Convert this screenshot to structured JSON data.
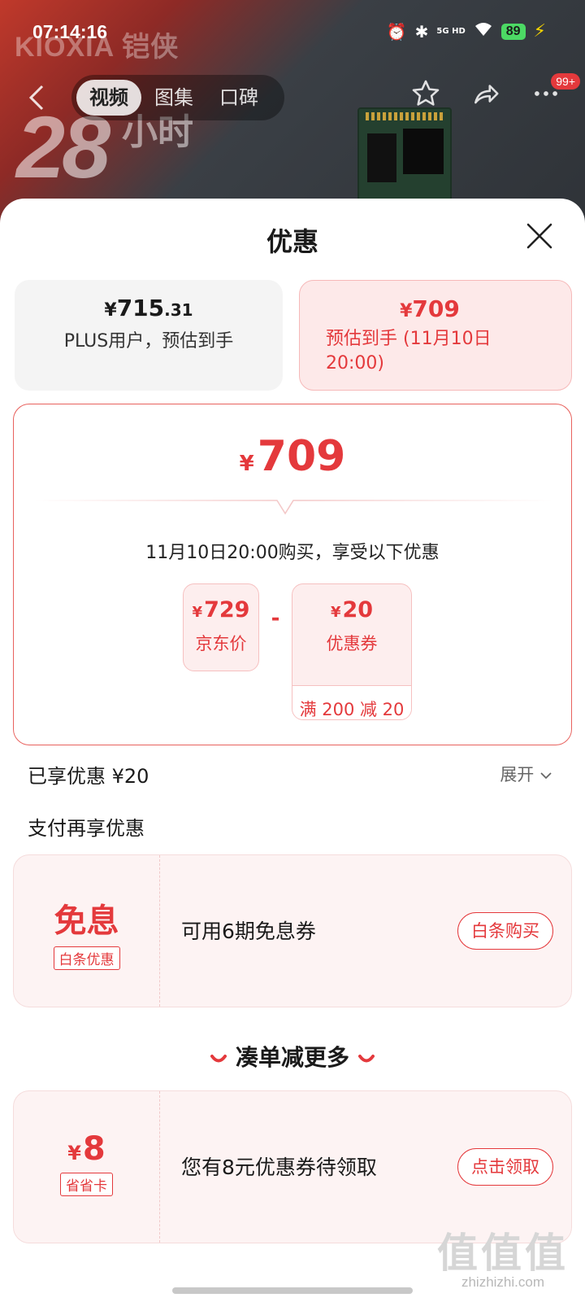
{
  "status": {
    "time": "07:14:16",
    "network": "5G HD",
    "battery": "89"
  },
  "hero": {
    "brand": "KIOXIA 铠侠",
    "promo_number": "28",
    "promo_text": "小时"
  },
  "nav": {
    "tabs": [
      "视频",
      "图集",
      "口碑"
    ],
    "active_tab": 0,
    "badge": "99+"
  },
  "sheet": {
    "title": "优惠",
    "options": [
      {
        "yen": "¥",
        "price_int": "715",
        "price_dec": ".31",
        "desc": "PLUS用户，预估到手"
      },
      {
        "yen": "¥",
        "price_int": "709",
        "price_dec": "",
        "desc": "预估到手 (11月10日 20:00)"
      }
    ],
    "detail": {
      "yen": "¥",
      "price": "709",
      "when": "11月10日20:00购买，享受以下优惠",
      "base": {
        "yen": "¥",
        "value": "729",
        "label": "京东价"
      },
      "minus": "-",
      "coupon": {
        "yen": "¥",
        "value": "20",
        "label": "优惠券",
        "rule": "满 200 减 20"
      }
    },
    "enjoyed": "已享优惠 ¥20",
    "expand": "展开",
    "pay_title": "支付再享优惠",
    "card_interest": {
      "big": "免息",
      "tag": "白条优惠",
      "text": "可用6期免息券",
      "button": "白条购买"
    },
    "more_title": "凑单减更多",
    "card_save": {
      "yen": "¥",
      "big": "8",
      "tag": "省省卡",
      "text": "您有8元优惠券待领取",
      "button": "点击领取"
    }
  },
  "watermark": {
    "logo": "值值值",
    "url": "zhizhizhi.com"
  },
  "colors": {
    "accent": "#e4393c",
    "accent_light": "#fde9e9"
  }
}
